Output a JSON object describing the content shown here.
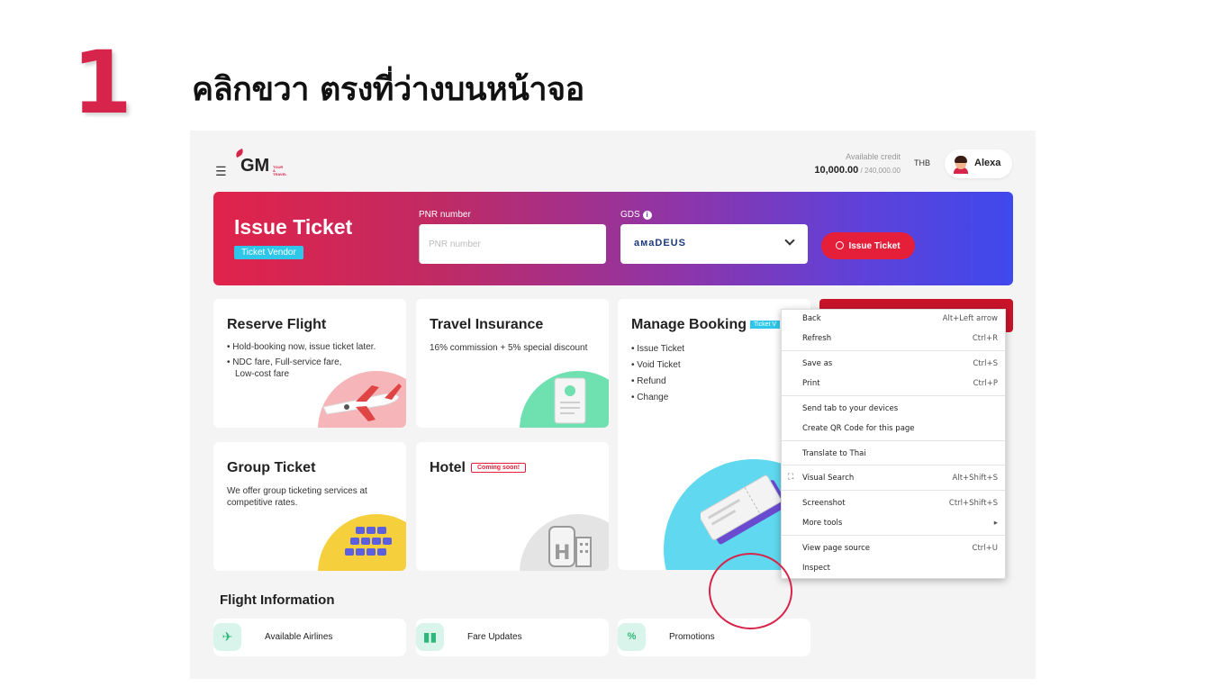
{
  "step": {
    "number": "1",
    "title": "คลิกขวา ตรงที่ว่างบนหน้าจอ"
  },
  "app": {
    "logo": {
      "text": "GM",
      "tagline": "TOUR & TRAVEL"
    },
    "credit": {
      "label": "Available credit",
      "value": "10,000.00",
      "max": " / 240,000.00",
      "currency": "THB"
    },
    "user": {
      "name": "Alexa"
    }
  },
  "banner": {
    "title": "Issue Ticket",
    "badge": "Ticket Vendor",
    "pnr_label": "PNR number",
    "pnr_placeholder": "PNR number",
    "gds_label": "GDS",
    "gds_value": "aмaDEUS",
    "issue_button": "Issue Ticket",
    "colors": {
      "start": "#e1234a",
      "end": "#3f49ec"
    }
  },
  "cards": {
    "reserve": {
      "title": "Reserve Flight",
      "bullets": [
        "• Hold-booking now, issue ticket later.",
        "• NDC fare, Full-service fare,",
        "Low-cost fare"
      ]
    },
    "insurance": {
      "title": "Travel Insurance",
      "text": "16% commission + 5% special discount"
    },
    "manage": {
      "title": "Manage Booking",
      "badge": "Ticket V",
      "bullets": [
        "• Issue Ticket",
        "• Void Ticket",
        "• Refund",
        "• Change"
      ]
    },
    "group": {
      "title": "Group Ticket",
      "text": "We offer group ticketing services at competitive rates."
    },
    "hotel": {
      "title": "Hotel",
      "badge": "Coming soon!"
    }
  },
  "flight_info": {
    "title": "Flight Information",
    "chips": [
      {
        "label": "Available Airlines",
        "icon": "plane-icon"
      },
      {
        "label": "Fare Updates",
        "icon": "bar-chart-icon"
      },
      {
        "label": "Promotions",
        "icon": "percent-icon"
      }
    ]
  },
  "context_menu": {
    "items": [
      {
        "label": "Back",
        "shortcut": "Alt+Left arrow"
      },
      {
        "label": "Refresh",
        "shortcut": "Ctrl+R"
      },
      {
        "label": "Save as",
        "shortcut": "Ctrl+S"
      },
      {
        "label": "Print",
        "shortcut": "Ctrl+P"
      },
      {
        "label": "Send tab to your devices",
        "shortcut": ""
      },
      {
        "label": "Create QR Code for this page",
        "shortcut": ""
      },
      {
        "label": "Translate to Thai",
        "shortcut": ""
      },
      {
        "label": "Visual Search",
        "shortcut": "Alt+Shift+S"
      },
      {
        "label": "Screenshot",
        "shortcut": "Ctrl+Shift+S"
      },
      {
        "label": "More tools",
        "shortcut": "▸"
      },
      {
        "label": "View page source",
        "shortcut": "Ctrl+U"
      },
      {
        "label": "Inspect",
        "shortcut": ""
      }
    ]
  }
}
